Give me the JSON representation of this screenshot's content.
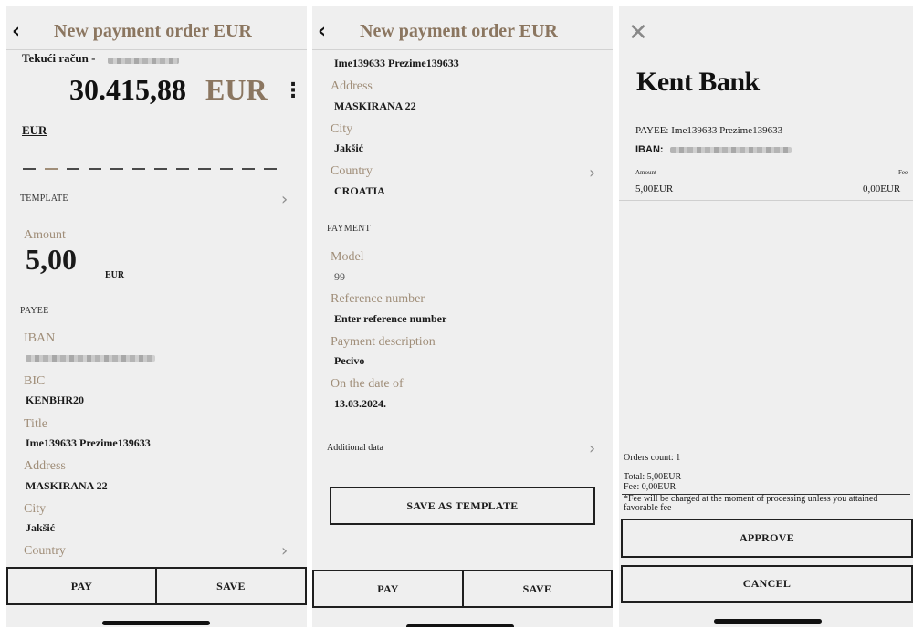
{
  "screen1": {
    "header": {
      "back_icon": "chevron-left",
      "title": "New payment order EUR"
    },
    "account": {
      "label": "Tekući račun -",
      "balance_amount": "30.415,88",
      "balance_currency": "EUR",
      "menu_icon": "kebab-menu"
    },
    "currency": "EUR",
    "template_label": "TEMPLATE",
    "amount": {
      "label": "Amount",
      "value": "5,00",
      "currency": "EUR"
    },
    "payee_section": "PAYEE",
    "iban_label": "IBAN",
    "bic": {
      "label": "BIC",
      "value": "KENBHR20"
    },
    "title": {
      "label": "Title",
      "value": "Ime139633 Prezime139633"
    },
    "address": {
      "label": "Address",
      "value": "MASKIRANA 22"
    },
    "city": {
      "label": "City",
      "value": "Jakšić"
    },
    "country_label": "Country",
    "buttons": {
      "pay": "PAY",
      "save": "SAVE"
    }
  },
  "screen2": {
    "header": {
      "back_icon": "chevron-left",
      "title": "New payment order EUR"
    },
    "payee_name": "Ime139633 Prezime139633",
    "address": {
      "label": "Address",
      "value": "MASKIRANA 22"
    },
    "city": {
      "label": "City",
      "value": "Jakšić"
    },
    "country": {
      "label": "Country",
      "value": "CROATIA"
    },
    "payment_section": "PAYMENT",
    "model": {
      "label": "Model",
      "value": "99"
    },
    "reference": {
      "label": "Reference number",
      "placeholder": "Enter reference number"
    },
    "description": {
      "label": "Payment description",
      "value": "Pecivo"
    },
    "date": {
      "label": "On the date of",
      "value": "13.03.2024."
    },
    "additional_data": "Additional data",
    "save_template": "SAVE AS TEMPLATE",
    "buttons": {
      "pay": "PAY",
      "save": "SAVE"
    }
  },
  "screen3": {
    "close_icon": "close-x",
    "bank_name": "Kent Bank",
    "payee_line": "PAYEE: Ime139633 Prezime139633",
    "iban_label": "IBAN:",
    "amount_label": "Amount",
    "fee_label": "Fee",
    "amount_value": "5,00EUR",
    "fee_value": "0,00EUR",
    "orders_count": "Orders count: 1",
    "total": "Total: 5,00EUR",
    "fee_total": "Fee: 0,00EUR",
    "fee_note": "*Fee will be charged at the moment of processing unless you attained favorable fee",
    "approve": "APPROVE",
    "cancel": "CANCEL"
  }
}
